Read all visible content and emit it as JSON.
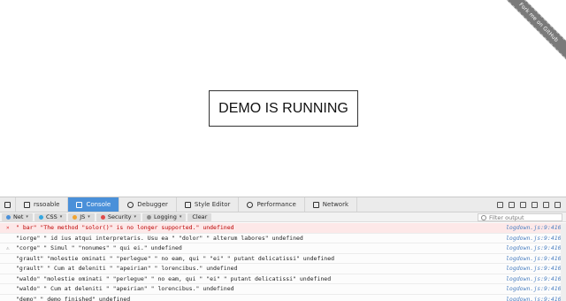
{
  "ribbon": {
    "label": "Fork me on GitHub"
  },
  "demo": {
    "label": "DEMO IS RUNNING"
  },
  "devtools": {
    "tabs": [
      {
        "label": "rssoable",
        "name": "tab-inspector-frame"
      },
      {
        "label": "Console",
        "name": "tab-console"
      },
      {
        "label": "Debugger",
        "name": "tab-debugger"
      },
      {
        "label": "Style Editor",
        "name": "tab-style-editor"
      },
      {
        "label": "Performance",
        "name": "tab-performance"
      },
      {
        "label": "Network",
        "name": "tab-network"
      }
    ],
    "filters": [
      {
        "label": "Net",
        "color": "#4a90d9"
      },
      {
        "label": "CSS",
        "color": "#35a7e0"
      },
      {
        "label": "JS",
        "color": "#f0a330"
      },
      {
        "label": "Security",
        "color": "#e04b4b"
      },
      {
        "label": "Logging",
        "color": "#8a8a8a"
      }
    ],
    "clear_label": "Clear",
    "filter_placeholder": "Filter output",
    "rows": [
      {
        "kind": "err",
        "gutter": "×",
        "text": "\" bar\"  \"The method  \"solor()\"  is no longer supported.\" undefined",
        "loc": "logdown.js:9:4100"
      },
      {
        "kind": "log",
        "gutter": "",
        "text": "\"iorge\" \" id ius atqui interpretaris. Usu ea \" \"dolor\" \" alterum labores\" undefined",
        "loc": "logdown.js:9:4100"
      },
      {
        "kind": "log",
        "gutter": "⚠",
        "text": "\"corge\" \" Simul \" \"nonumes\" \" qui ei.\" undefined",
        "loc": "logdown.js:9:4100"
      },
      {
        "kind": "log",
        "gutter": "",
        "text": "\"grault\" \"molestie ominati \" \"perlegue\" \" no eam, qui \" \"ei\" \" putant delicatissi\" undefined",
        "loc": "logdown.js:9:4100"
      },
      {
        "kind": "log",
        "gutter": "",
        "text": "\"grault\" \" Cum at deleniti \" \"apeirian\" \" lorencibus.\" undefined",
        "loc": "logdown.js:9:4100"
      },
      {
        "kind": "log",
        "gutter": "",
        "text": "\"waldo\" \"molestie ominati \" \"perlegue\" \" no eam, qui \" \"ei\" \" putant delicatissi\" undefined",
        "loc": "logdown.js:9:4100"
      },
      {
        "kind": "log",
        "gutter": "",
        "text": "\"waldo\" \" Cum at deleniti \" \"apeirian\" \" lorencibus.\" undefined",
        "loc": "logdown.js:9:4100"
      },
      {
        "kind": "log",
        "gutter": "",
        "text": "\"demo\" \" demo finished\" undefined",
        "loc": "logdown.js:9:4100"
      }
    ]
  }
}
